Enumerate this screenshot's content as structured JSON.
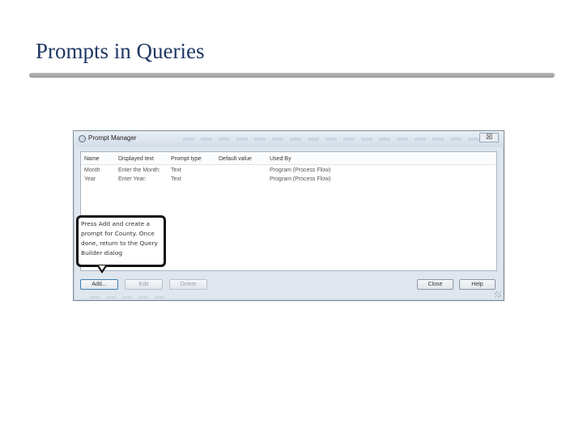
{
  "slide": {
    "title": "Prompts in Queries"
  },
  "dialog": {
    "title": "Prompt Manager",
    "close_glyph": "☒",
    "columns": [
      "Name",
      "Displayed text",
      "Prompt type",
      "Default value",
      "Used By"
    ],
    "rows": [
      {
        "name": "Month",
        "displayed": "Enter the Month:",
        "type": "Text",
        "default": "",
        "used_by": "Program (Process Flow)"
      },
      {
        "name": "Year",
        "displayed": "Enter Year:",
        "type": "Text",
        "default": "",
        "used_by": "Program (Process Flow)"
      }
    ],
    "buttons": {
      "add": "Add...",
      "edit": "Edit",
      "delete": "Delete",
      "close": "Close",
      "help": "Help"
    }
  },
  "callout": {
    "text": "Press Add and create a prompt for County. Once done, return to the Query Builder dialog"
  }
}
